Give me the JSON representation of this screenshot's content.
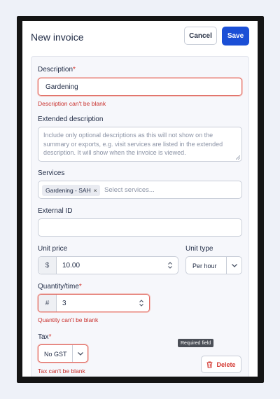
{
  "header": {
    "title": "New invoice",
    "cancel_label": "Cancel",
    "save_label": "Save"
  },
  "form": {
    "description": {
      "label": "Description",
      "required_mark": "*",
      "value": "Gardening",
      "error": "Description can't be blank"
    },
    "extended_description": {
      "label": "Extended description",
      "placeholder": "Include only optional descriptions as this will not show on the summary or exports, e.g. visit services are listed in the extended description. It will show when the invoice is viewed."
    },
    "services": {
      "label": "Services",
      "chips": [
        "Gardening - SAH"
      ],
      "chip_remove": "×",
      "placeholder": "Select services..."
    },
    "external_id": {
      "label": "External ID",
      "value": ""
    },
    "unit_price": {
      "label": "Unit price",
      "prefix": "$",
      "value": "10.00"
    },
    "unit_type": {
      "label": "Unit type",
      "value": "Per hour"
    },
    "quantity": {
      "label": "Quantity/time",
      "required_mark": "*",
      "prefix": "#",
      "value": "3",
      "error": "Quantity can't be blank"
    },
    "tax": {
      "label": "Tax",
      "required_mark": "*",
      "value": "No GST",
      "error": "Tax can't be blank"
    }
  },
  "tooltip": "Required field",
  "delete_label": "Delete",
  "colors": {
    "primary": "#1b4fd6",
    "error": "#c9302c",
    "border": "#c9ced8"
  }
}
